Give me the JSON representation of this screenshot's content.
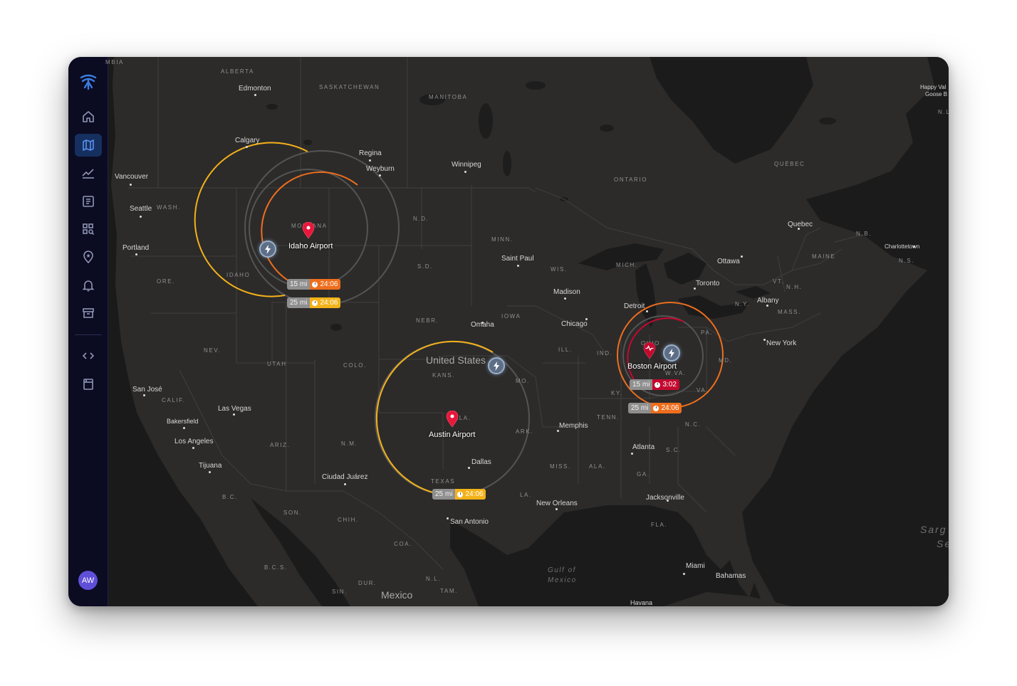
{
  "user": {
    "initials": "AW"
  },
  "sidebar": {
    "items": [
      {
        "name": "home-icon"
      },
      {
        "name": "map-icon",
        "active": true
      },
      {
        "name": "trend-icon"
      },
      {
        "name": "reports-icon"
      },
      {
        "name": "apps-search-icon"
      },
      {
        "name": "location-star-icon"
      },
      {
        "name": "bell-icon"
      },
      {
        "name": "archive-icon"
      },
      {
        "name": "code-icon"
      },
      {
        "name": "notebook-icon"
      }
    ]
  },
  "colors": {
    "accent": "#3b6fd6",
    "ring_yellow": "#f4b21a",
    "ring_orange": "#ee6e1d",
    "ring_red": "#c4092f",
    "pin_red": "#e8173b"
  },
  "airports": [
    {
      "name": "Idaho Airport",
      "badges": [
        {
          "dist": "15 mi",
          "time": "24:06",
          "color": "#ee6e1d"
        },
        {
          "dist": "25 mi",
          "time": "24:06",
          "color": "#f4b21a"
        }
      ]
    },
    {
      "name": "Austin Airport",
      "badges": [
        {
          "dist": "25 mi",
          "time": "24:06",
          "color": "#f4b21a"
        }
      ]
    },
    {
      "name": "Boston Airport",
      "badges": [
        {
          "dist": "15 mi",
          "time": "3:02",
          "color": "#c4092f"
        },
        {
          "dist": "25 mi",
          "time": "24:06",
          "color": "#ee6e1d"
        }
      ]
    }
  ],
  "map": {
    "countries": [
      "United States",
      "Mexico"
    ],
    "cities": [
      "Edmonton",
      "Calgary",
      "Regina",
      "Weyburn",
      "Winnipeg",
      "Vancouver",
      "Seattle",
      "Portland",
      "Saint Paul",
      "Madison",
      "Chicago",
      "Omaha",
      "Detroit",
      "Toronto",
      "Ottawa",
      "Quebec",
      "Albany",
      "New York",
      "Charlottetown",
      "Happy Val",
      "Goose B",
      "San José",
      "Las Vegas",
      "Bakersfield",
      "Los Angeles",
      "Tijuana",
      "Ciudad Juárez",
      "Dallas",
      "San Antonio",
      "Memphis",
      "Atlanta",
      "Jacksonville",
      "New Orleans",
      "Miami",
      "Bahamas",
      "Havana"
    ],
    "regions": [
      "MBIA",
      "ALBERTA",
      "SASKATCHEWAN",
      "MANITOBA",
      "ONTARIO",
      "QUÉBEC",
      "N.L",
      "WASH.",
      "MONTANA",
      "N.D.",
      "MINN.",
      "IDAHO",
      "ORE.",
      "S.D.",
      "WIS.",
      "MICH.",
      "N.B.",
      "MAINE",
      "N.S.",
      "VT.",
      "N.H.",
      "MASS.",
      "N.Y.",
      "PA.",
      "NEBR.",
      "IOWA",
      "ILL.",
      "IND.",
      "OHIO",
      "W.VA.",
      "MD.",
      "VA.",
      "KY.",
      "NEV.",
      "UTAH",
      "COLO.",
      "KANS.",
      "MO.",
      "CALIF.",
      "ARIZ.",
      "N.M.",
      "OKLA.",
      "ARK.",
      "TENN.",
      "N.C.",
      "S.C.",
      "GA.",
      "ALA.",
      "MISS.",
      "LA.",
      "TEXAS",
      "FLA.",
      "B.C.",
      "SON.",
      "CHIH.",
      "COA.",
      "B.C.S.",
      "DUR.",
      "N.L.",
      "SIN.",
      "TAM."
    ],
    "waters": [
      "Gulf of",
      "Mexico",
      "Sarg",
      "Se"
    ]
  }
}
